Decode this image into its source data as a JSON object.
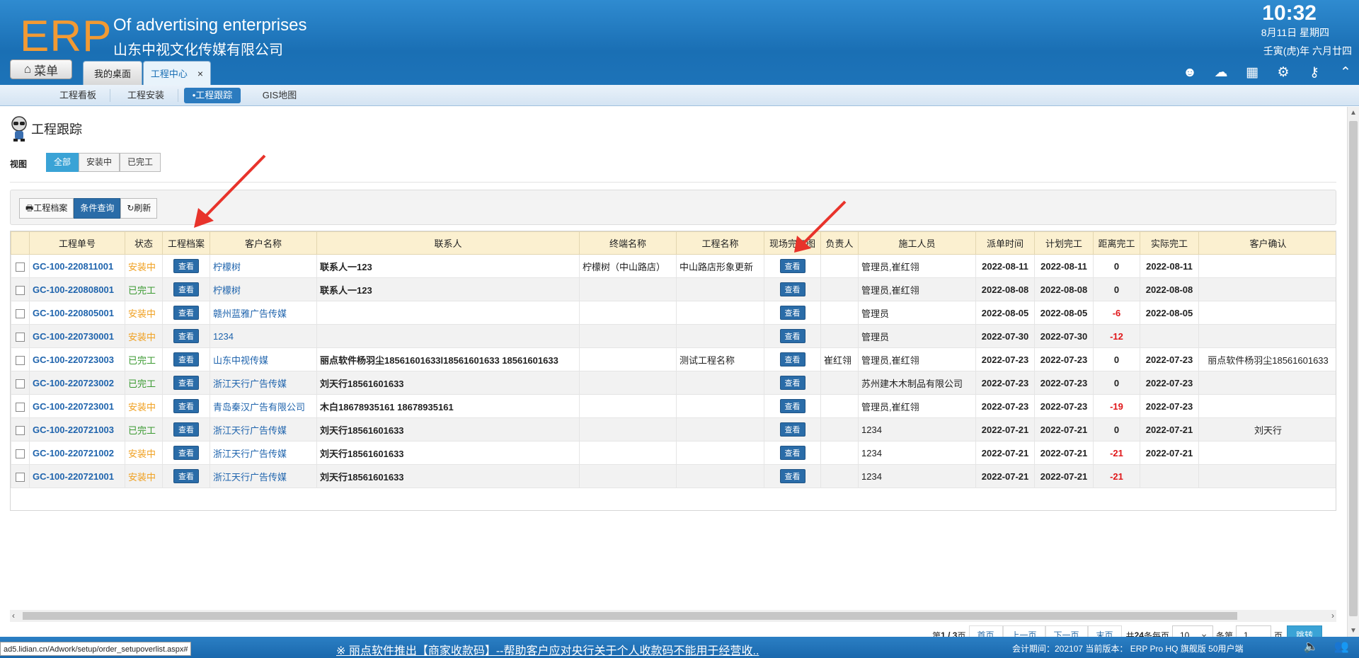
{
  "header": {
    "logo": "ERP",
    "company_en": "Of advertising enterprises",
    "company_cn": "山东中视文化传媒有限公司",
    "time": "10:32",
    "date": "8月11日 星期四",
    "lunar": "壬寅(虎)年 六月廿四",
    "menu_label": "菜单",
    "tabs": [
      {
        "label": "我的桌面"
      },
      {
        "label": "工程中心",
        "close": "×"
      }
    ],
    "icons": [
      "user-icon",
      "cloud-upload-icon",
      "apps-grid-icon",
      "gear-icon",
      "key-icon",
      "collapse-icon"
    ]
  },
  "subnav": [
    "工程看板",
    "工程安装",
    "•工程跟踪",
    "GIS地图"
  ],
  "page": {
    "title": "工程跟踪",
    "view_label": "视图",
    "view_buttons": [
      "全部",
      "安装中",
      "已完工"
    ],
    "toolbar": [
      "工程档案",
      "条件查询",
      "刷新"
    ]
  },
  "table": {
    "columns": [
      "",
      "工程单号",
      "状态",
      "工程档案",
      "客户名称",
      "联系人",
      "终端名称",
      "工程名称",
      "现场完工图",
      "负责人",
      "施工人员",
      "派单时间",
      "计划完工",
      "距离完工",
      "实际完工",
      "客户确认"
    ],
    "view_label": "查看",
    "rows": [
      {
        "no": "GC-100-220811001",
        "status": "安装中",
        "customer": "柠檬树",
        "contact": "联系人一123",
        "terminal": "柠檬树（中山路店）",
        "project": "中山路店形象更新",
        "owner": "",
        "workers": "管理员,崔红翎",
        "dispatch": "2022-08-11",
        "plan": "2022-08-11",
        "remain": "0",
        "actual": "2022-08-11",
        "confirm": ""
      },
      {
        "no": "GC-100-220808001",
        "status": "已完工",
        "customer": "柠檬树",
        "contact": "联系人一123",
        "terminal": "",
        "project": "",
        "owner": "",
        "workers": "管理员,崔红翎",
        "dispatch": "2022-08-08",
        "plan": "2022-08-08",
        "remain": "0",
        "actual": "2022-08-08",
        "confirm": ""
      },
      {
        "no": "GC-100-220805001",
        "status": "安装中",
        "customer": "赣州蓝雅广告传媒",
        "contact": "",
        "terminal": "",
        "project": "",
        "owner": "",
        "workers": "管理员",
        "dispatch": "2022-08-05",
        "plan": "2022-08-05",
        "remain": "-6",
        "actual": "2022-08-05",
        "confirm": ""
      },
      {
        "no": "GC-100-220730001",
        "status": "安装中",
        "customer": "1234",
        "contact": "",
        "terminal": "",
        "project": "",
        "owner": "",
        "workers": "管理员",
        "dispatch": "2022-07-30",
        "plan": "2022-07-30",
        "remain": "-12",
        "actual": "",
        "confirm": ""
      },
      {
        "no": "GC-100-220723003",
        "status": "已完工",
        "customer": "山东中视传媒",
        "contact": "丽点软件杨羽尘18561601633l18561601633 18561601633",
        "terminal": "",
        "project": "测试工程名称",
        "owner": "崔红翎",
        "workers": "管理员,崔红翎",
        "dispatch": "2022-07-23",
        "plan": "2022-07-23",
        "remain": "0",
        "actual": "2022-07-23",
        "confirm": "丽点软件杨羽尘18561601633"
      },
      {
        "no": "GC-100-220723002",
        "status": "已完工",
        "customer": "浙江天行广告传媒",
        "contact": "刘天行18561601633",
        "terminal": "",
        "project": "",
        "owner": "",
        "workers": "苏州建木木制品有限公司",
        "dispatch": "2022-07-23",
        "plan": "2022-07-23",
        "remain": "0",
        "actual": "2022-07-23",
        "confirm": ""
      },
      {
        "no": "GC-100-220723001",
        "status": "安装中",
        "customer": "青岛秦汉广告有限公司",
        "contact": "木白18678935161 18678935161",
        "terminal": "",
        "project": "",
        "owner": "",
        "workers": "管理员,崔红翎",
        "dispatch": "2022-07-23",
        "plan": "2022-07-23",
        "remain": "-19",
        "actual": "2022-07-23",
        "confirm": ""
      },
      {
        "no": "GC-100-220721003",
        "status": "已完工",
        "customer": "浙江天行广告传媒",
        "contact": "刘天行18561601633",
        "terminal": "",
        "project": "",
        "owner": "",
        "workers": "1234",
        "dispatch": "2022-07-21",
        "plan": "2022-07-21",
        "remain": "0",
        "actual": "2022-07-21",
        "confirm": "刘天行"
      },
      {
        "no": "GC-100-220721002",
        "status": "安装中",
        "customer": "浙江天行广告传媒",
        "contact": "刘天行18561601633",
        "terminal": "",
        "project": "",
        "owner": "",
        "workers": "1234",
        "dispatch": "2022-07-21",
        "plan": "2022-07-21",
        "remain": "-21",
        "actual": "2022-07-21",
        "confirm": ""
      },
      {
        "no": "GC-100-220721001",
        "status": "安装中",
        "customer": "浙江天行广告传媒",
        "contact": "刘天行18561601633",
        "terminal": "",
        "project": "",
        "owner": "",
        "workers": "1234",
        "dispatch": "2022-07-21",
        "plan": "2022-07-21",
        "remain": "-21",
        "actual": "",
        "confirm": ""
      }
    ]
  },
  "pager": {
    "page_prefix": "第",
    "page_info": "1 / 3",
    "page_suffix": "页",
    "first": "首页",
    "prev": "上一页",
    "next": "下一页",
    "last": "末页",
    "total_prefix": "共",
    "total": "24",
    "total_suffix": "条每页",
    "page_size": "10",
    "size_suffix": "条第",
    "page_input": "1",
    "page_input_suffix": "页",
    "go": "跳转"
  },
  "footer": {
    "url": "ad5.lidian.cn/Adwork/setup/order_setupoverlist.aspx#",
    "notice": "※ 丽点软件推出【商家收款码】--帮助客户应对央行关于个人收款码不能用于经营收..",
    "meta": "会计期间：202107 当前版本：  ERP Pro HQ 旗舰版 50用户端"
  },
  "colors": {
    "header_blue": "#1a6fb4",
    "logo_orange": "#f29a33",
    "status_installing": "#f0a020",
    "status_done": "#3b9a31",
    "overdue_red": "#e0171a",
    "annotation_arrow": "#e8332b"
  }
}
